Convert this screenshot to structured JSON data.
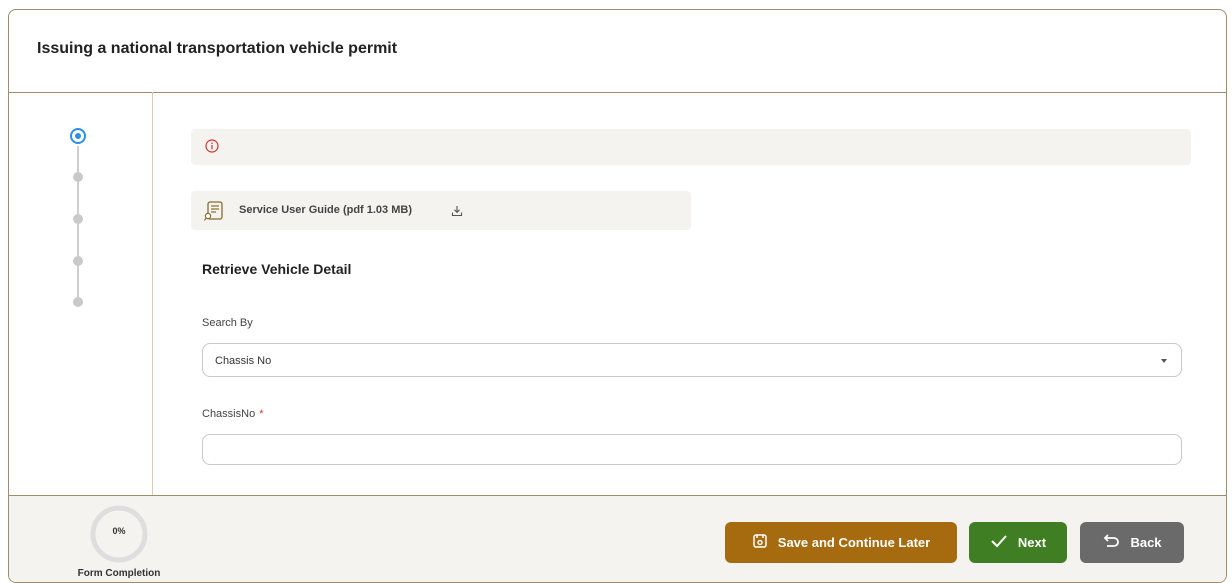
{
  "header": {
    "title": "Issuing a national transportation vehicle permit"
  },
  "stepper": {
    "total_steps": 5,
    "active_step": 1
  },
  "alert": {
    "icon": "info-icon",
    "color": "#d6342c"
  },
  "guide": {
    "label": "Service User Guide (pdf 1.03 MB)",
    "icon": "document-icon",
    "download_icon": "download-icon"
  },
  "form": {
    "section_title": "Retrieve Vehicle Detail",
    "search_by": {
      "label": "Search By",
      "value": "Chassis No"
    },
    "chassis_no": {
      "label": "ChassisNo",
      "required_mark": "*",
      "value": ""
    }
  },
  "footer": {
    "progress": {
      "percent_text": "0%",
      "value": 0,
      "label": "Form Completion"
    },
    "buttons": {
      "save_label": "Save and Continue Later",
      "next_label": "Next",
      "back_label": "Back"
    }
  },
  "colors": {
    "accent": "#2e8fe6",
    "save": "#a56b0e",
    "next": "#3f7e23",
    "back": "#6a6a6a",
    "border": "#a08c6a"
  }
}
